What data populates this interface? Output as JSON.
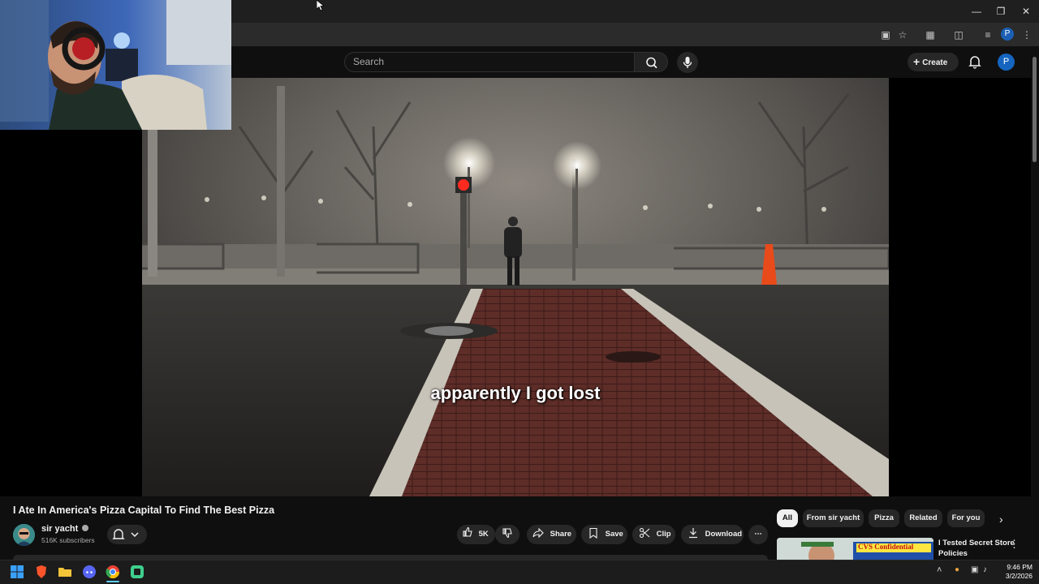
{
  "search": {
    "placeholder": "Search"
  },
  "header": {
    "create_label": "Create",
    "avatar_letter": "P"
  },
  "browser": {
    "profile_letter": "P"
  },
  "video": {
    "subtitle": "apparently I got lost"
  },
  "watch": {
    "title": "I Ate In America's Pizza Capital To Find The Best Pizza",
    "channel_name": "sir yacht",
    "subscribers": "516K subscribers",
    "like_count": "5K",
    "share_label": "Share",
    "save_label": "Save",
    "clip_label": "Clip",
    "download_label": "Download"
  },
  "chips": [
    {
      "label": "All"
    },
    {
      "label": "From sir yacht"
    },
    {
      "label": "Pizza"
    },
    {
      "label": "Related"
    },
    {
      "label": "For you"
    }
  ],
  "recommended": {
    "title": "I Tested Secret Store Policies",
    "thumb_text": "CVS Confidential"
  },
  "taskbar": {
    "time": "9:46 PM",
    "date": "3/2/2026"
  },
  "colors": {
    "accent": "#1565c0",
    "bg": "#0f0f0f",
    "chip_bg": "#272727"
  }
}
